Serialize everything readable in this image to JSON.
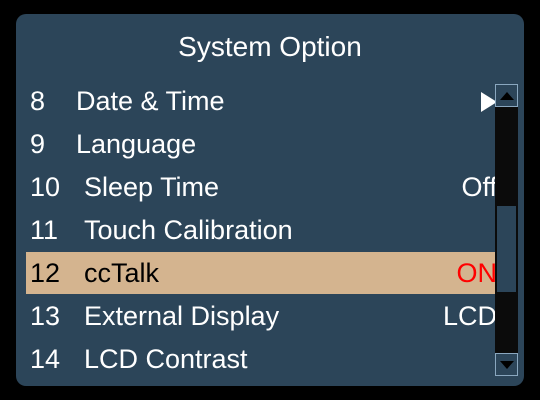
{
  "title": "System Option",
  "menu": {
    "items": [
      {
        "number": "8",
        "label": "Date & Time",
        "value": ""
      },
      {
        "number": "9",
        "label": "Language",
        "value": ""
      },
      {
        "number": "10",
        "label": "Sleep Time",
        "value": "Off"
      },
      {
        "number": "11",
        "label": "Touch Calibration",
        "value": ""
      },
      {
        "number": "12",
        "label": "ccTalk",
        "value": "ON"
      },
      {
        "number": "13",
        "label": "External Display",
        "value": "LCD"
      },
      {
        "number": "14",
        "label": "LCD Contrast",
        "value": ""
      }
    ],
    "selected_index": 4
  },
  "icons": {
    "submenu": "submenu-arrow-icon",
    "scroll_up": "scroll-up-icon",
    "scroll_down": "scroll-down-icon"
  },
  "colors": {
    "background": "#2c4559",
    "highlight": "#d4b48f",
    "on_value": "#ff0000"
  }
}
